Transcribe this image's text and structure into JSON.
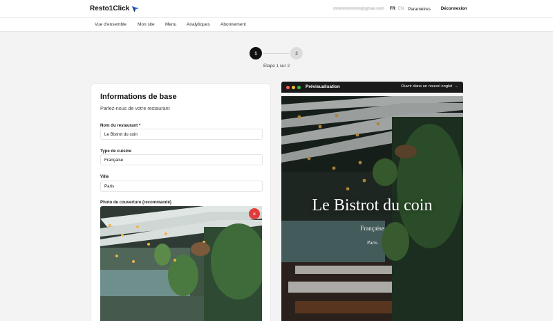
{
  "header": {
    "brand": "Resto1Click",
    "user_email": "mmmmmmmm@gmail.com",
    "lang_active": "FR",
    "lang_other": "EN",
    "settings": "Paramètres",
    "logout": "Déconnexion"
  },
  "nav": {
    "items": [
      {
        "label": "Vue d'ensemble"
      },
      {
        "label": "Mon site"
      },
      {
        "label": "Menu"
      },
      {
        "label": "Analytiques"
      },
      {
        "label": "Abonnement"
      }
    ]
  },
  "stepper": {
    "step1": "1",
    "step2": "2",
    "text": "Étape 1 sur 2"
  },
  "form": {
    "title": "Informations de base",
    "subtitle": "Parlez-nous de votre restaurant",
    "name_label": "Nom du restaurant *",
    "name_value": "Le Bistrot du coin",
    "cuisine_label": "Type de cuisine",
    "cuisine_value": "Française",
    "city_label": "Ville",
    "city_value": "Paris",
    "photo_label": "Photo de couverture (recommandé)",
    "remove_icon": "×"
  },
  "preview": {
    "title": "Prévisualisation",
    "open_tab": "Ouvrir dans un nouvel onglet",
    "open_tab_arrow": "→",
    "hero_title": "Le Bistrot du coin",
    "hero_cuisine": "Française",
    "hero_city": "Paris"
  },
  "colors": {
    "accent_dark": "#111111",
    "danger": "#e23b3b",
    "window_red": "#ff5f57",
    "window_yellow": "#febc2e",
    "window_green": "#28c840"
  }
}
